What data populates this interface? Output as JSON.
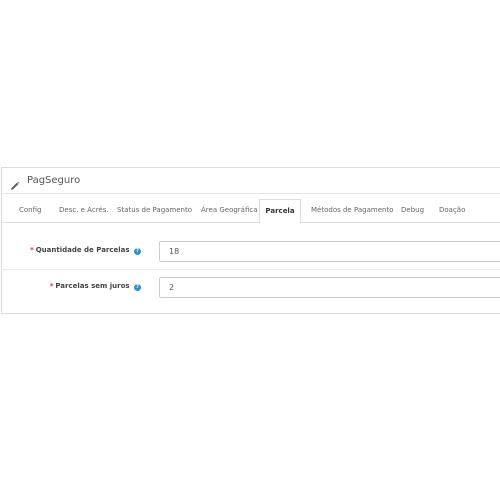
{
  "panel": {
    "title": "PagSeguro"
  },
  "tabs": [
    "Config",
    "Desc. e Acrés.",
    "Status de Pagamento",
    "Área Geográfica",
    "Parcela",
    "Métodos de Pagamento",
    "Debug",
    "Doação"
  ],
  "active_tab": "Parcela",
  "fields": [
    {
      "label": "Quantidade de Parcelas",
      "value": "18",
      "required": true,
      "help": "?"
    },
    {
      "label": "Parcelas sem juros",
      "value": "2",
      "required": true,
      "help": "?"
    }
  ],
  "required_marker": "*",
  "colors": {
    "required": "#e0302b",
    "help_icon": "#2b94cc",
    "active_tab_border": "#dddddd"
  }
}
